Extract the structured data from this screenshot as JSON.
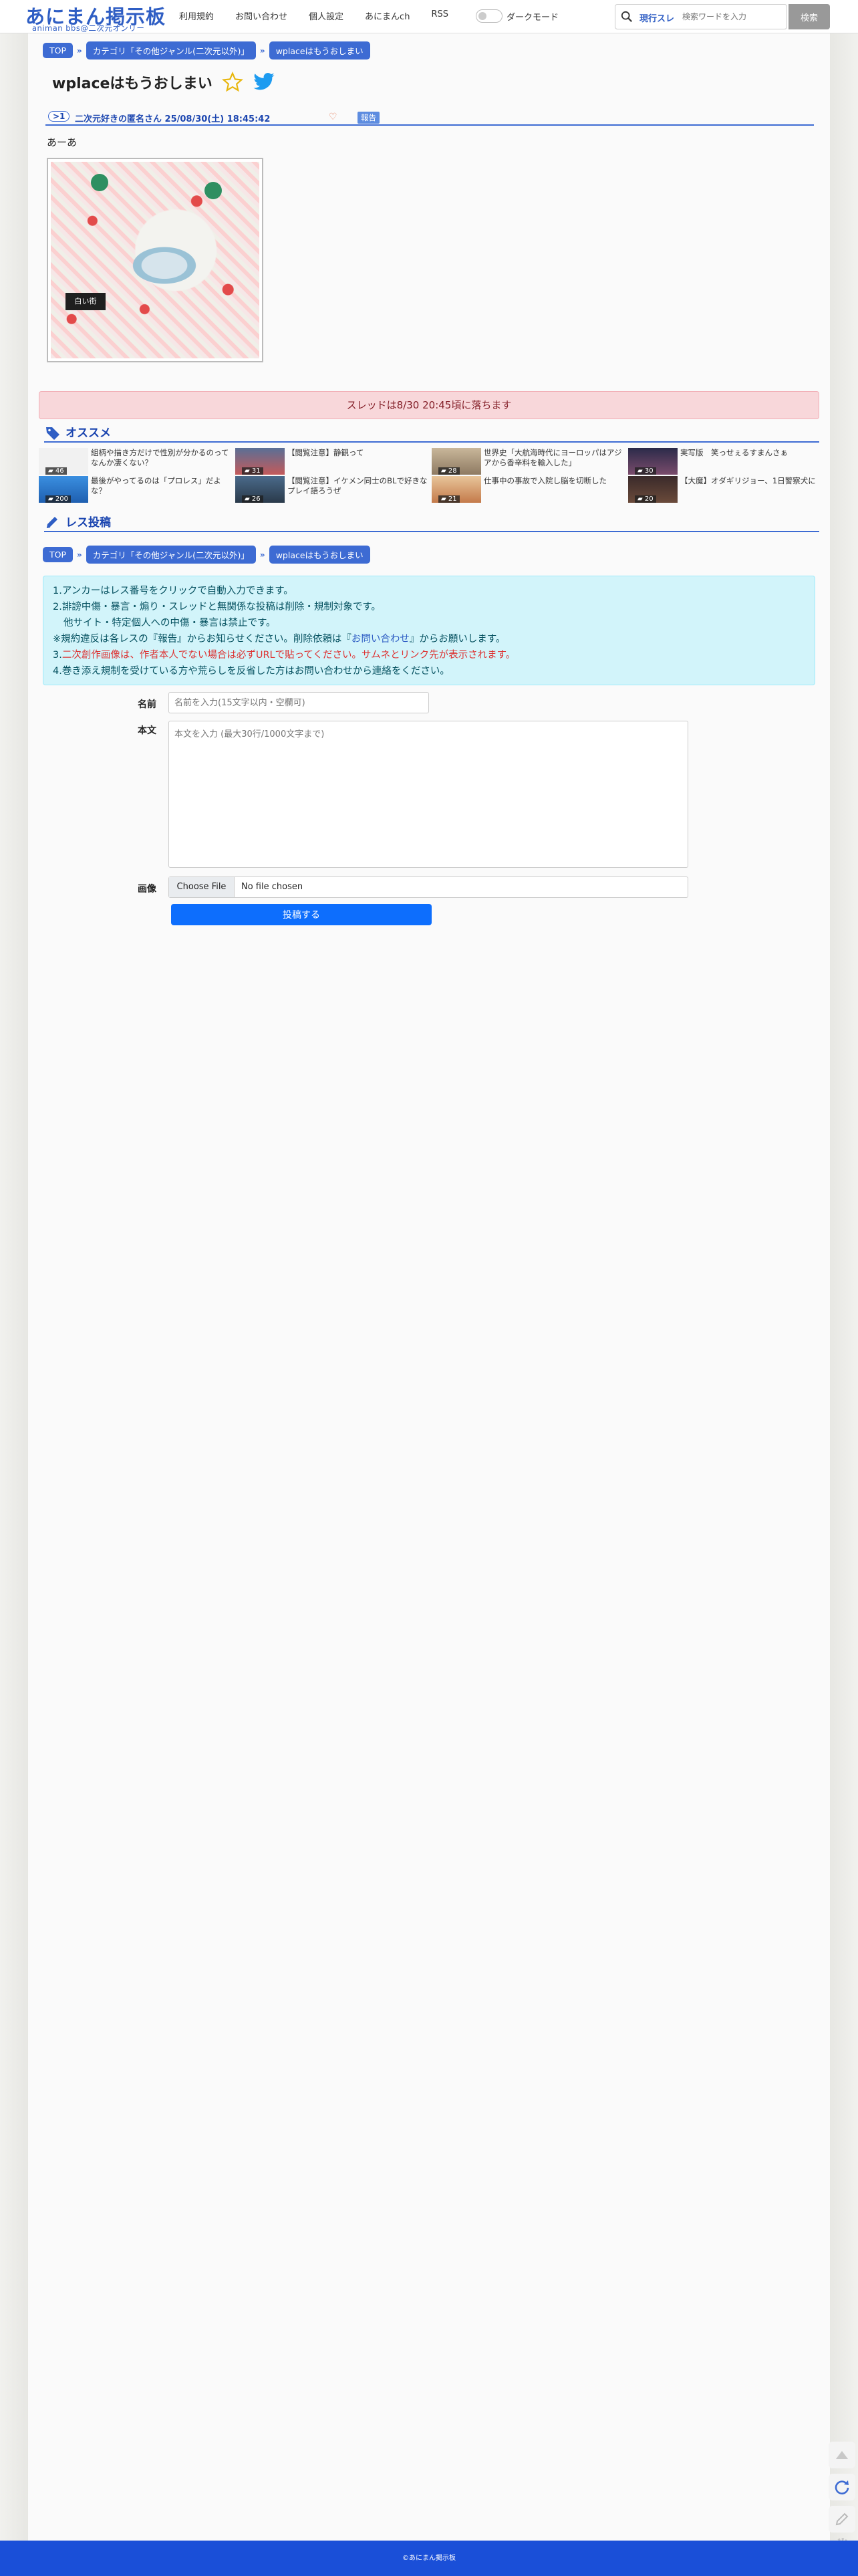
{
  "header": {
    "logo_main": "あにまん掲示板",
    "logo_sub": "animan bbs@二次元オンリー",
    "nav": [
      "利用規約",
      "お問い合わせ",
      "個人設定",
      "あにまんch",
      "RSS"
    ],
    "dark_mode_label": "ダークモード",
    "search_mode": "現行スレ",
    "search_placeholder": "検索ワードを入力",
    "search_button": "検索"
  },
  "breadcrumb": [
    "TOP",
    "カテゴリ「その他ジャンル(二次元以外)」",
    "wplaceはもうおしまい"
  ],
  "thread": {
    "title": "wplaceはもうおしまい",
    "post_number": ">1",
    "post_meta": "二次元好きの匿名さん  25/08/30(土) 18:45:42",
    "report_label": "報告",
    "post_body": "あーあ",
    "image_text": "白い街"
  },
  "expire_notice": "スレッドは8/30 20:45頃に落ちます",
  "recommend": {
    "title": "オススメ",
    "items": [
      {
        "text": "組柄や描き方だけで性別が分かるのってなんか凄くない？",
        "count": "46"
      },
      {
        "text": "【閲覧注意】静観って",
        "count": "31"
      },
      {
        "text": "世界史「大航海時代にヨーロッパはアジアから香辛料を輸入した」",
        "count": "28"
      },
      {
        "text": "実写版　笑っせぇるすまんさぁ",
        "count": "30"
      },
      {
        "text": "最後がやってるのは「プロレス」だよな？",
        "count": "200"
      },
      {
        "text": "【閲覧注意】イケメン同士のBLで好きなプレイ語ろうぜ",
        "count": "26"
      },
      {
        "text": "仕事中の事故で入院し脳を切断した",
        "count": "21"
      },
      {
        "text": "【大魔】オダギリジョー、1日警察犬に",
        "count": "20"
      }
    ]
  },
  "post_form": {
    "title": "レス投稿",
    "rules": [
      "1.アンカーはレス番号をクリックで自動入力できます。",
      "2.誹謗中傷・暴言・煽り・スレッドと無関係な投稿は削除・規制対象です。",
      "他サイト・特定個人への中傷・暴言は禁止です。",
      "※規約違反は各レスの『報告』からお知らせください。削除依頼は『",
      "お問い合わせ",
      "』からお願いします。",
      "3.",
      "二次創作画像は、作者本人でない場合は必ずURLで貼ってください。サムネとリンク先が表示されます。",
      "4.巻き添え規制を受けている方や荒らしを反省した方はお問い合わせから連絡をください。"
    ],
    "name_label": "名前",
    "name_placeholder": "名前を入力(15文字以内・空欄可)",
    "body_label": "本文",
    "body_placeholder": "本文を入力 (最大30行/1000文字まで)",
    "image_label": "画像",
    "file_button": "Choose File",
    "file_status": "No file chosen",
    "submit_label": "投稿する"
  },
  "footer": "©あにまん掲示板",
  "colors": {
    "brand": "#2f5ec4",
    "crumb": "#3d6bd3",
    "alert_bg": "#f8d7da",
    "info_bg": "#d2f4fa",
    "submit": "#0d6efd",
    "footer": "#1a4fd8"
  }
}
